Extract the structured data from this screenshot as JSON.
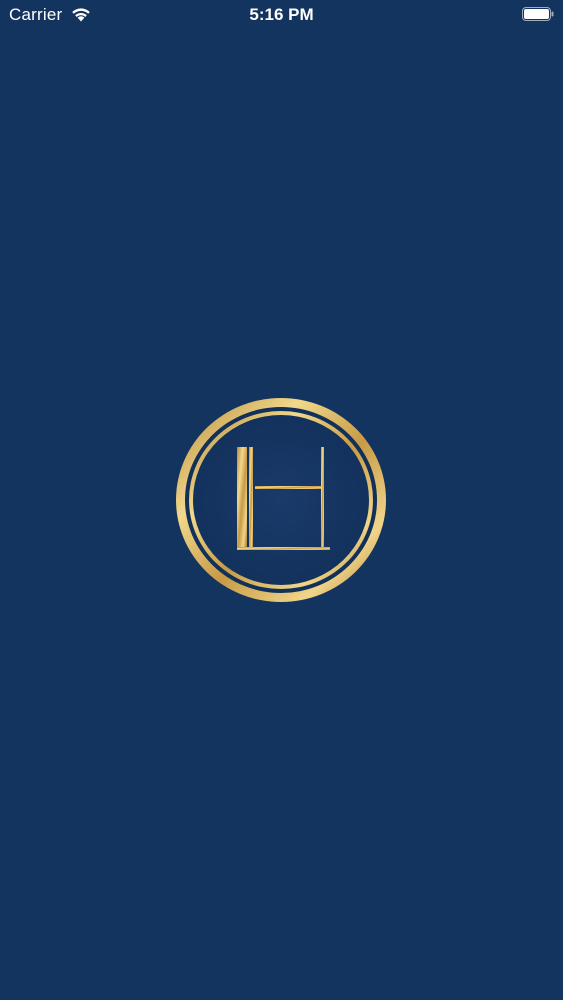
{
  "status_bar": {
    "carrier": "Carrier",
    "time": "5:16 PM",
    "wifi_icon": "wifi-icon",
    "battery_icon": "battery-icon",
    "battery_level": 1.0
  },
  "splash": {
    "background_color": "#12345e",
    "logo_icon": "lh-monogram-logo",
    "logo_letters": "LH",
    "gold_color": "#d4b062"
  }
}
